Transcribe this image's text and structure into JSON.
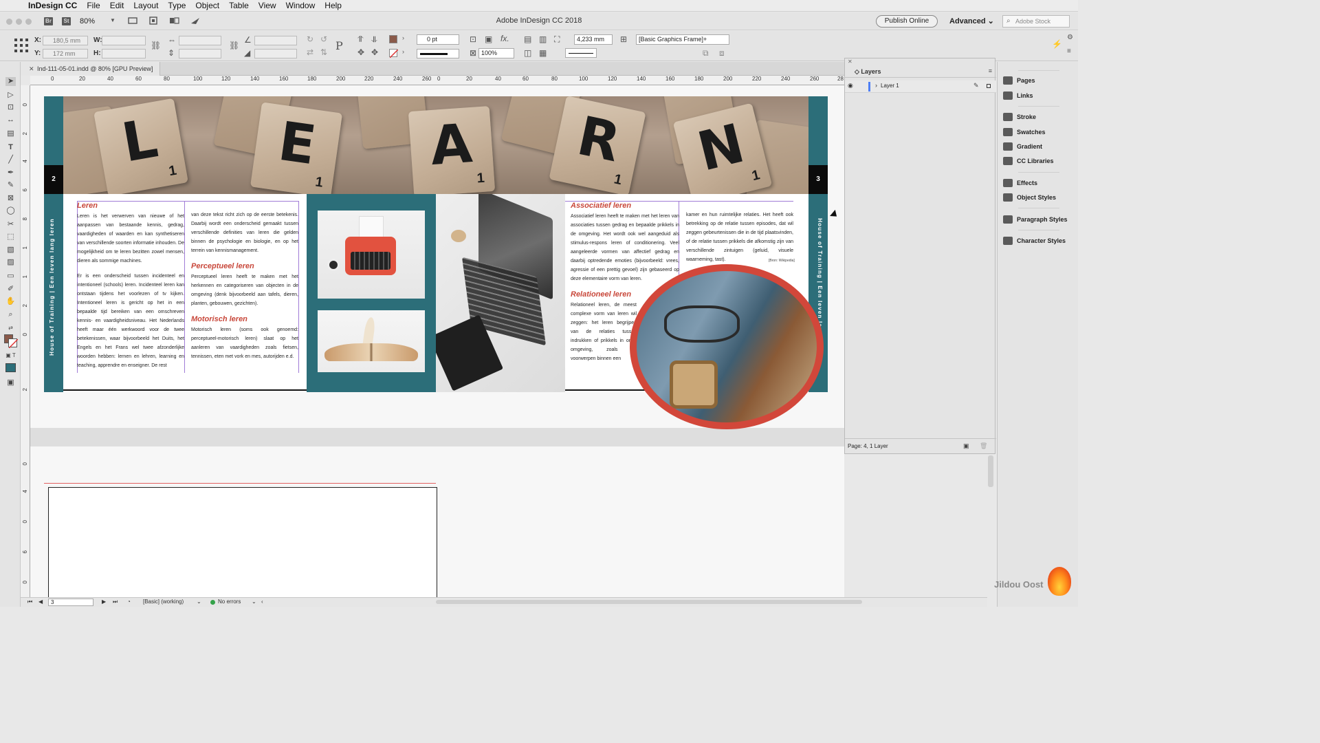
{
  "menubar": {
    "items": [
      "InDesign CC",
      "File",
      "Edit",
      "Layout",
      "Type",
      "Object",
      "Table",
      "View",
      "Window",
      "Help"
    ]
  },
  "titlebar": {
    "window_title": "Adobe InDesign CC 2018",
    "br_label": "Br",
    "st_label": "St",
    "zoom": "80%",
    "publish_online": "Publish Online",
    "workspace": "Advanced",
    "stock_placeholder": "Adobe Stock"
  },
  "controlbar": {
    "x_label": "X:",
    "y_label": "Y:",
    "w_label": "W:",
    "h_label": "H:",
    "x_value": "180,5 mm",
    "y_value": "172 mm",
    "stroke_weight": "0 pt",
    "scale_percent": "100%",
    "fitting_value": "4,233 mm",
    "object_style": "[Basic Graphics Frame]+",
    "fill_color": "#8a5a4a"
  },
  "document": {
    "tab_title": "Ind-111-05-01.indd @ 80% [GPU Preview]"
  },
  "rulers": {
    "horizontal": [
      "0",
      "20",
      "40",
      "60",
      "80",
      "100",
      "120",
      "140",
      "160",
      "180",
      "200",
      "220",
      "240",
      "260",
      "0",
      "20",
      "40",
      "60",
      "80",
      "100",
      "120",
      "140",
      "160",
      "180",
      "200",
      "220",
      "240",
      "260",
      "28"
    ],
    "vertical": [
      "0",
      "2",
      "4",
      "6",
      "8",
      "1",
      "1",
      "2",
      "0",
      "2",
      "0",
      "4",
      "0",
      "6",
      "0"
    ]
  },
  "spread": {
    "page_left_number": "2",
    "page_right_number": "3",
    "side_label": "House of Training  |  Een leven lang leren",
    "banner_letters": [
      {
        "letter": "L",
        "sub": "1"
      },
      {
        "letter": "E",
        "sub": "1"
      },
      {
        "letter": "A",
        "sub": "1"
      },
      {
        "letter": "R",
        "sub": "1"
      },
      {
        "letter": "N",
        "sub": "1"
      }
    ],
    "left_col1": {
      "heading": "Leren",
      "p1": "Leren is het verwerven van nieuwe of het aanpassen van bestaande kennis, gedrag, vaardigheden of waarden en kan synthetiseren van verschillende soorten informatie inhouden. De mogelijkheid om te leren bezitten zowel mensen, dieren als sommige machines.",
      "p2": "Er is een onderscheid tussen incidenteel en intentioneel (schools) leren. Incidenteel leren kan ontstaan tijdens het voorlezen of tv kijken. Intentioneel leren is gericht op het in een bepaalde tijd bereiken van een omschreven kennis- en vaardigheidsniveau. Het Nederlands heeft maar één werkwoord voor de twee betekenissen, waar bijvoorbeeld het Duits, het Engels en het Frans wel twee afzonderlijke woorden hebben: lernen en lehren, learning en teaching, apprendre en enseigner. De rest"
    },
    "left_col2": {
      "p1": "van deze tekst richt zich op de eerste betekenis. Daarbij wordt een onderscheid gemaakt tussen verschillende definities van leren die gelden binnen de psychologie en biologie, en op het terrein van kennismanagement.",
      "heading2": "Perceptueel leren",
      "p2": "Perceptueel leren heeft te maken met het herkennen en categoriseren van objecten in de omgeving (denk bijvoorbeeld aan tafels, dieren, planten, gebouwen, gezichten).",
      "heading3": "Motorisch leren",
      "p3": "Motorisch leren (soms ook genoemd: perceptueel-motorisch leren) slaat op het aanleren van vaardigheden zoals fietsen, tennissen, eten met vork en mes, autorijden e.d."
    },
    "right_col1": {
      "heading": "Associatief leren",
      "p1": "Associatief leren heeft te maken met het leren van associaties tussen gedrag en bepaalde prikkels in de omgeving. Het wordt ook wel aangeduid als stimulus-respons leren of conditionering. Veel aangeleerde vormen van affectief gedrag en daarbij optredende emoties (bijvoorbeeld: vrees, agressie of een prettig gevoel) zijn gebaseerd op deze elementaire vorm van leren.",
      "heading2": "Relationeel leren",
      "p2": "Relationeel leren, de meest complexe vorm van leren wil zeggen: het leren begrijpen van de relaties tussen indrukken of prikkels in onze omgeving, zoals de voorwerpen binnen een"
    },
    "right_col2": {
      "p1": "kamer en hun ruimtelijke relaties. Het heeft ook betrekking op de relatie tussen episodes, dat wil zeggen gebeurtenissen die in de tijd plaatsvinden, of de relatie tussen prikkels die afkomstig zijn van verschillende zintuigen (geluid, visuele waarneming, tast).",
      "source": "[Bron: Wikipedia]"
    }
  },
  "layers_panel": {
    "title": "Layers",
    "layer_name": "Layer 1",
    "footer_info": "Page: 4, 1 Layer"
  },
  "dock": {
    "items": [
      "Pages",
      "Links",
      "Stroke",
      "Swatches",
      "Gradient",
      "CC Libraries",
      "Effects",
      "Object Styles",
      "Paragraph Styles",
      "Character Styles"
    ]
  },
  "statusbar": {
    "page_value": "3",
    "preflight_profile": "[Basic] (working)",
    "errors": "No errors"
  },
  "watermark": "Jildou Oost",
  "colors": {
    "teal": "#2c6e79",
    "heading_red": "#c8473a",
    "circle_border": "#d2473a",
    "layer_color": "#4f7ff5"
  }
}
